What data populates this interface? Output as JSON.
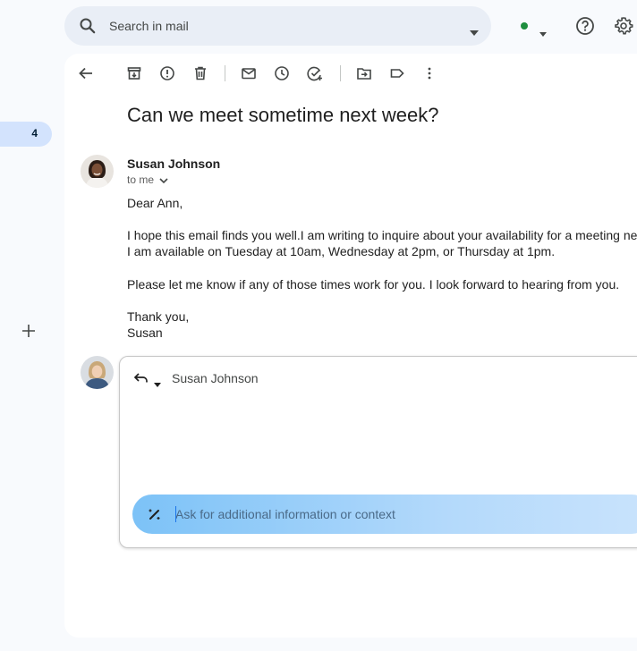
{
  "rail": {
    "badge_count": "4"
  },
  "search": {
    "placeholder": "Search in mail"
  },
  "email": {
    "subject": "Can we meet sometime next week?",
    "sender": "Susan Johnson",
    "recipient_line": "to me",
    "body": [
      "Dear Ann,",
      "I hope this email finds you well.I am writing to inquire about your availability for a meeting next w",
      "I am available on Tuesday at 10am, Wednesday at 2pm, or Thursday at 1pm.",
      "Please let me know if any of those times work for you. I look forward to hearing from you.",
      "Thank you,",
      "Susan"
    ]
  },
  "reply": {
    "recipient": "Susan Johnson",
    "ask_placeholder": "Ask for additional information or context"
  },
  "colors": {
    "status_online": "#1e8e3e",
    "badge_bg": "#d3e3fd",
    "ask_gradient_start": "#7cc2f7"
  },
  "icons": {
    "toolbar": [
      "back-arrow-icon",
      "archive-icon",
      "report-spam-icon",
      "delete-icon",
      "mark-unread-icon",
      "snooze-icon",
      "add-task-icon",
      "move-to-icon",
      "label-icon",
      "more-vert-icon"
    ]
  }
}
